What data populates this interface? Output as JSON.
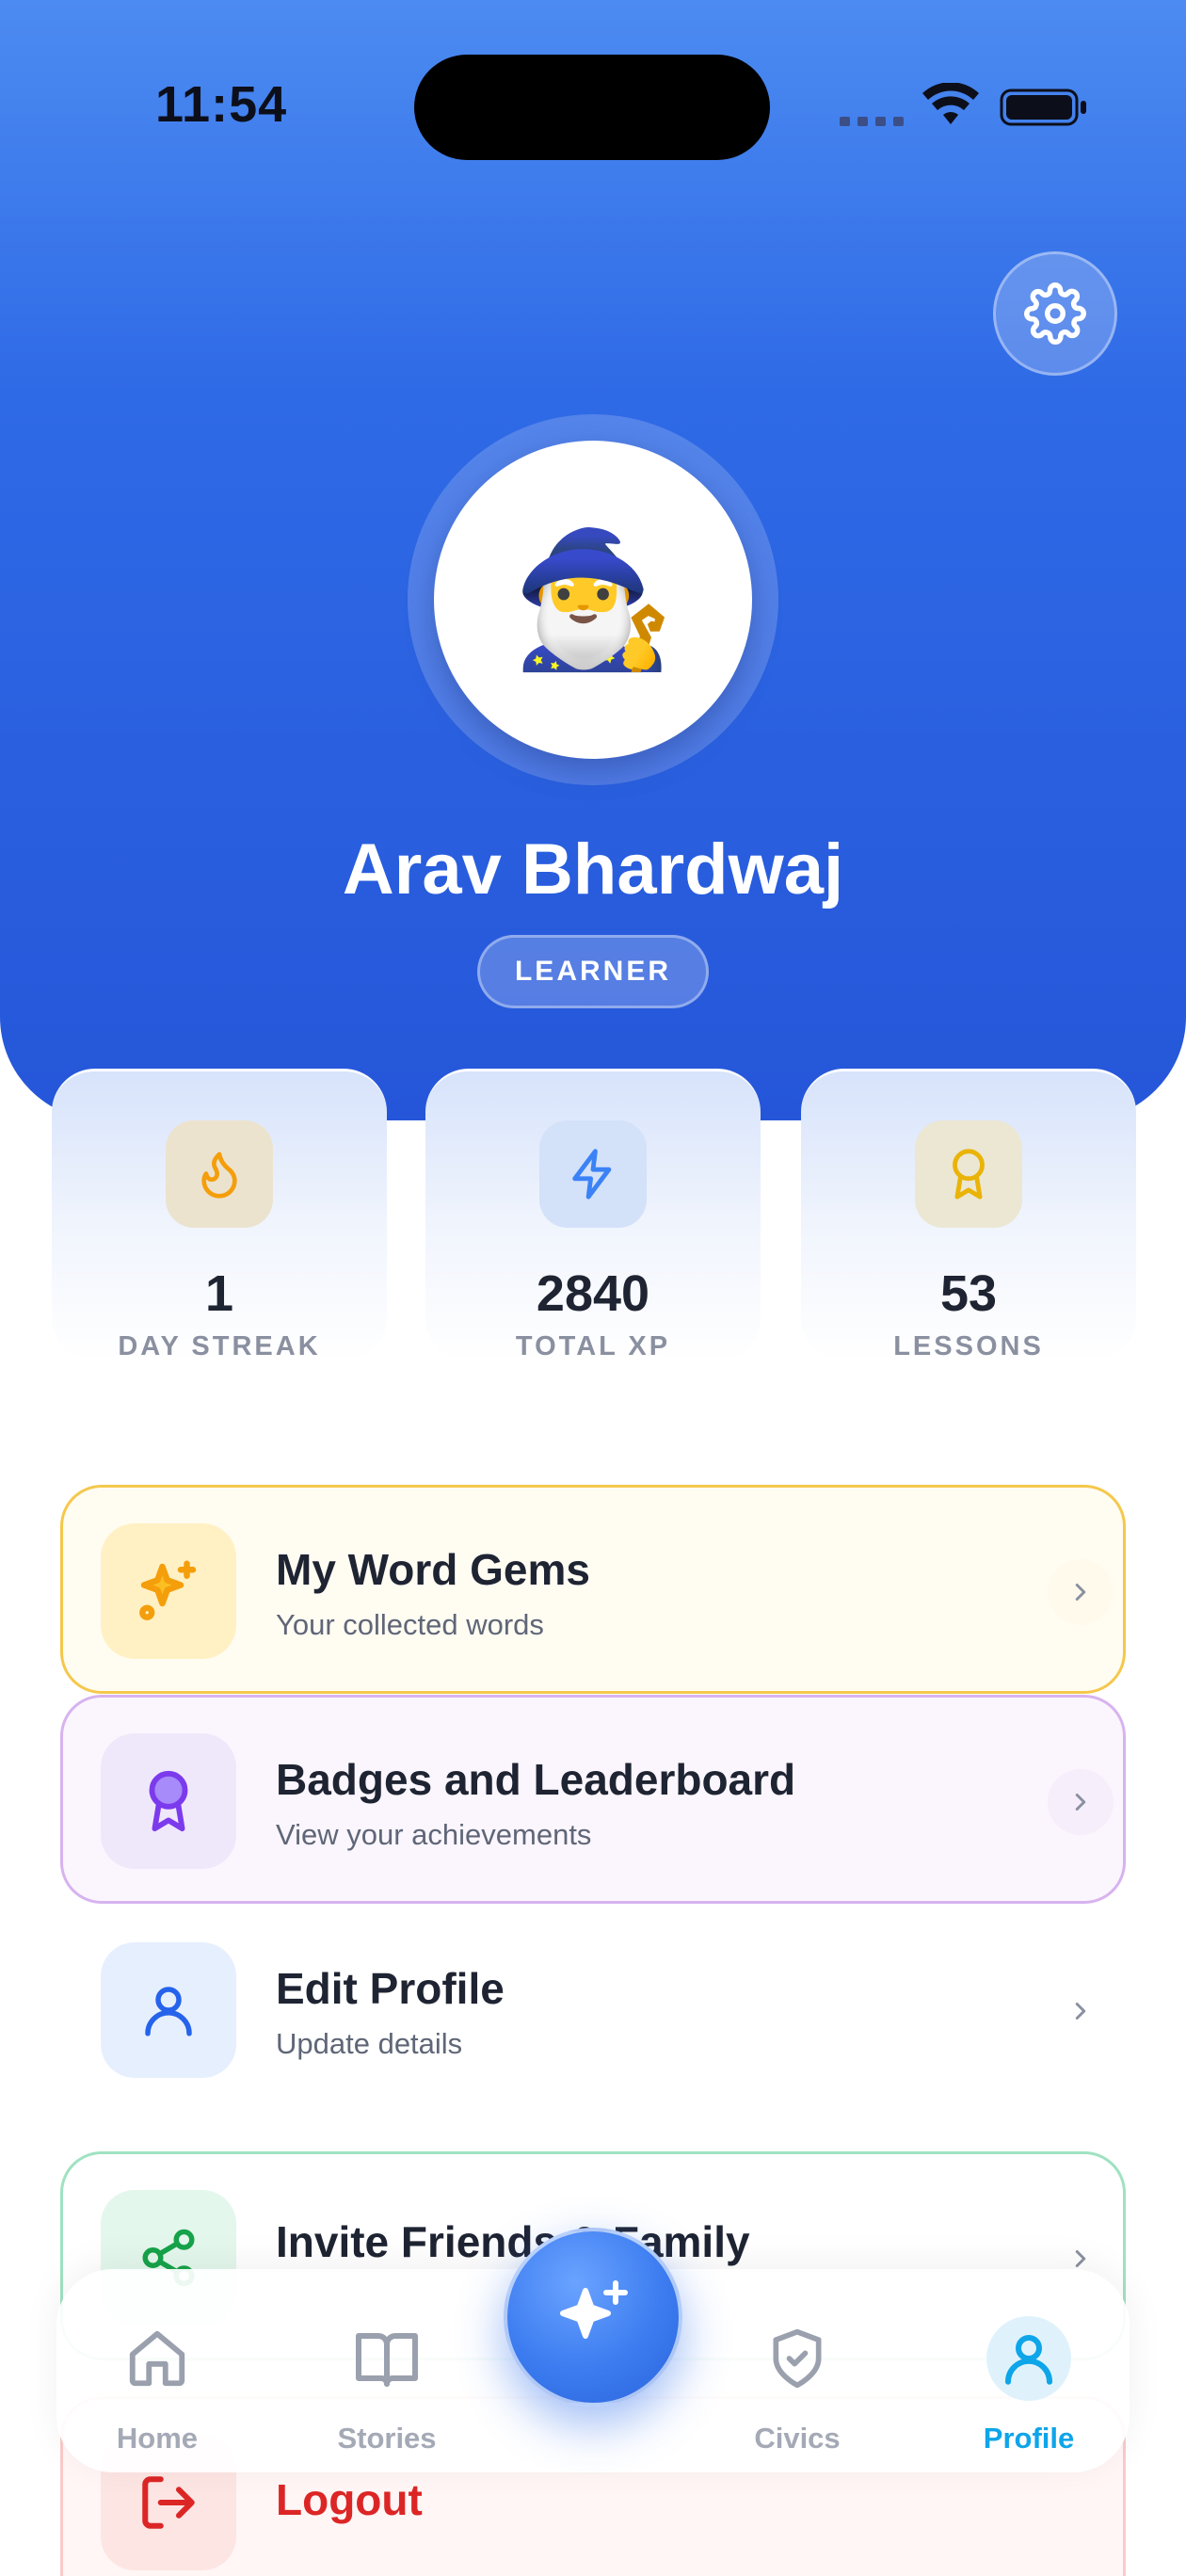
{
  "status_bar": {
    "time": "11:54"
  },
  "profile": {
    "name": "Arav Bhardwaj",
    "role": "LEARNER",
    "avatar_emoji": "🧙‍♂️"
  },
  "stats": [
    {
      "value": "1",
      "label": "DAY STREAK",
      "icon": "flame-icon",
      "color": "#f59e0b"
    },
    {
      "value": "2840",
      "label": "TOTAL XP",
      "icon": "lightning-icon",
      "color": "#3b82f6"
    },
    {
      "value": "53",
      "label": "LESSONS",
      "icon": "award-icon",
      "color": "#eab308"
    }
  ],
  "menu": [
    {
      "title": "My Word Gems",
      "subtitle": "Your collected words",
      "icon": "sparkles-icon",
      "accent": "#f5c84c"
    },
    {
      "title": "Badges and Leaderboard",
      "subtitle": "View your achievements",
      "icon": "badge-icon",
      "accent": "#d7b3ef"
    },
    {
      "title": "Edit Profile",
      "subtitle": "Update details",
      "icon": "user-icon",
      "accent": "#3b82f6"
    },
    {
      "title": "Invite Friends & Family",
      "subtitle": "",
      "icon": "share-icon",
      "accent": "#9fe2c1"
    },
    {
      "title": "Logout",
      "subtitle": "",
      "icon": "logout-icon",
      "accent": "#dc2626"
    }
  ],
  "tabs": [
    {
      "label": "Home",
      "icon": "home-icon",
      "active": false
    },
    {
      "label": "Stories",
      "icon": "book-icon",
      "active": false
    },
    {
      "label": "",
      "icon": "sparkle-plus-icon",
      "active": false
    },
    {
      "label": "Civics",
      "icon": "shield-check-icon",
      "active": false
    },
    {
      "label": "Profile",
      "icon": "profile-icon",
      "active": true
    }
  ],
  "colors": {
    "primary": "#2f6ae6",
    "active_tab": "#0ea5e9",
    "logout": "#dc2626"
  }
}
